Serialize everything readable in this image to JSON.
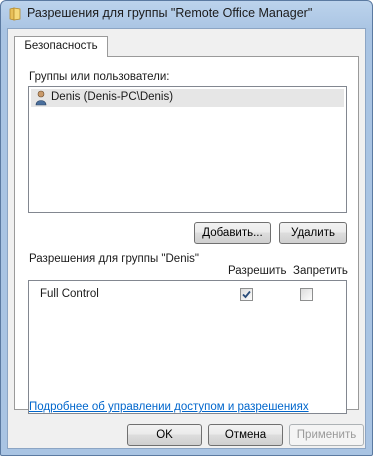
{
  "window": {
    "title": "Разрешения для группы \"Remote Office Manager\""
  },
  "tabs": [
    {
      "label": "Безопасность"
    }
  ],
  "groups": {
    "label": "Группы или пользователи:",
    "items": [
      {
        "name": "Denis (Denis-PC\\Denis)"
      }
    ]
  },
  "buttons": {
    "add": "Добавить...",
    "remove": "Удалить",
    "ok": "OK",
    "cancel": "Отмена",
    "apply": "Применить"
  },
  "permissions": {
    "label": "Разрешения для группы \"Denis\"",
    "allow_header": "Разрешить",
    "deny_header": "Запретить",
    "rows": [
      {
        "name": "Full Control",
        "allow": true,
        "deny": false
      }
    ]
  },
  "link": {
    "text": "Подробнее об управлении доступом и разрешениях"
  },
  "colors": {
    "link": "#0066cc",
    "titlebar": "#a9c4e3"
  }
}
